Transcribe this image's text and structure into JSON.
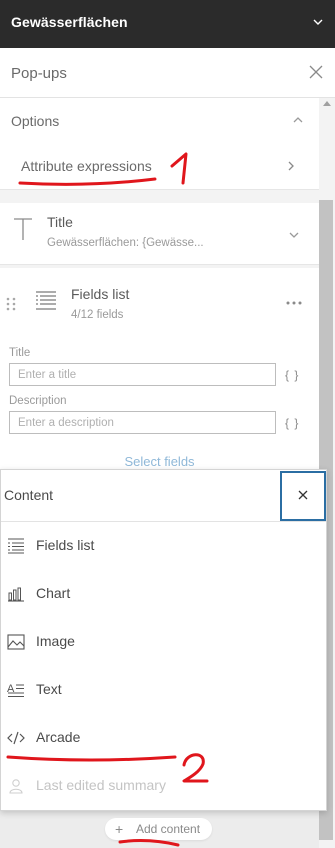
{
  "topbar": {
    "title": "Gewässerflächen",
    "icon": "chevron-down-icon"
  },
  "header": {
    "title": "Pop-ups",
    "icon": "close-icon"
  },
  "options": {
    "label": "Options",
    "icon": "chevron-up-icon",
    "attribute_expressions": {
      "label": "Attribute expressions",
      "icon": "chevron-right-icon"
    }
  },
  "title_card": {
    "label": "Title",
    "subtitle": "Gewässerflächen: {Gewässe...",
    "icon": "text-t-icon"
  },
  "fields_card": {
    "label": "Fields list",
    "count": "4/12 fields",
    "title_label": "Title",
    "title_placeholder": "Enter a title",
    "description_label": "Description",
    "description_placeholder": "Enter a description",
    "braces": "{ }",
    "select_fields": "Select fields"
  },
  "content_menu": {
    "title": "Content",
    "close_icon": "close-icon",
    "items": [
      {
        "label": "Fields list",
        "icon": "list-icon",
        "enabled": true
      },
      {
        "label": "Chart",
        "icon": "bar-chart-icon",
        "enabled": true
      },
      {
        "label": "Image",
        "icon": "image-icon",
        "enabled": true
      },
      {
        "label": "Text",
        "icon": "text-icon",
        "enabled": true
      },
      {
        "label": "Arcade",
        "icon": "code-icon",
        "enabled": true
      },
      {
        "label": "Last edited summary",
        "icon": "user-icon",
        "enabled": false
      }
    ]
  },
  "add_content": {
    "label": "Add content",
    "plus": "+"
  },
  "annotations": {
    "mark_1": "1",
    "mark_2": "2",
    "color": "#e0161c"
  }
}
